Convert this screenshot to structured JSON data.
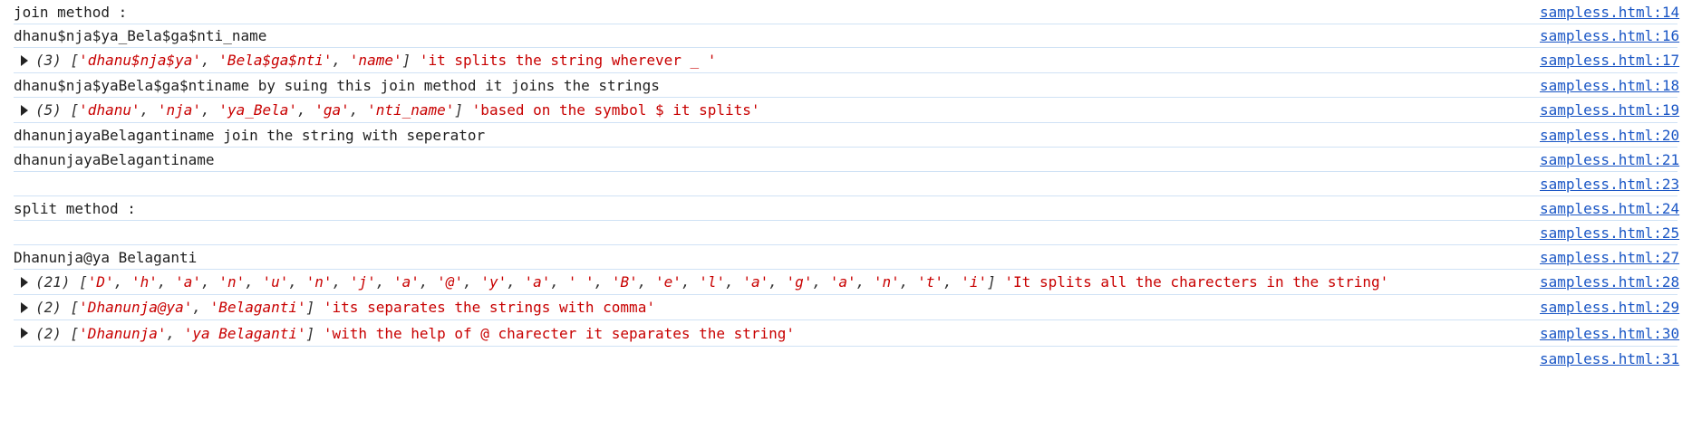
{
  "log": [
    {
      "kind": "text",
      "text": "join method :",
      "source": "sampless.html:14"
    },
    {
      "kind": "text",
      "text": "dhanu$nja$ya_Bela$ga$nti_name",
      "source": "sampless.html:16"
    },
    {
      "kind": "array",
      "count": "(3)",
      "items": [
        "'dhanu$nja$ya'",
        "'Bela$ga$nti'",
        "'name'"
      ],
      "note": "'it splits the string wherever _ '",
      "source": "sampless.html:17"
    },
    {
      "kind": "text",
      "text": "dhanu$nja$yaBela$ga$ntiname by suing this join method it joins the strings",
      "source": "sampless.html:18"
    },
    {
      "kind": "array",
      "count": "(5)",
      "items": [
        "'dhanu'",
        "'nja'",
        "'ya_Bela'",
        "'ga'",
        "'nti_name'"
      ],
      "note": "'based on the symbol $ it splits'",
      "source": "sampless.html:19"
    },
    {
      "kind": "text",
      "text": "dhanunjayaBelagantiname join the string with seperator",
      "source": "sampless.html:20"
    },
    {
      "kind": "text",
      "text": "dhanunjayaBelagantiname",
      "source": "sampless.html:21"
    },
    {
      "kind": "text",
      "text": "",
      "source": "sampless.html:23"
    },
    {
      "kind": "text",
      "text": "split method :",
      "source": "sampless.html:24"
    },
    {
      "kind": "text",
      "text": "",
      "source": "sampless.html:25"
    },
    {
      "kind": "text",
      "text": "Dhanunja@ya Belaganti",
      "source": "sampless.html:27"
    },
    {
      "kind": "array",
      "count": "(21)",
      "items": [
        "'D'",
        "'h'",
        "'a'",
        "'n'",
        "'u'",
        "'n'",
        "'j'",
        "'a'",
        "'@'",
        "'y'",
        "'a'",
        "' '",
        "'B'",
        "'e'",
        "'l'",
        "'a'",
        "'g'",
        "'a'",
        "'n'",
        "'t'",
        "'i'"
      ],
      "note": "'It splits all the charecters in the string'",
      "source": "sampless.html:28"
    },
    {
      "kind": "array",
      "count": "(2)",
      "items": [
        "'Dhanunja@ya'",
        "'Belaganti'"
      ],
      "note": "'its separates the strings with comma'",
      "source": "sampless.html:29"
    },
    {
      "kind": "array",
      "count": "(2)",
      "items": [
        "'Dhanunja'",
        "'ya Belaganti'"
      ],
      "note": "'with the help of @ charecter it separates the string'",
      "source": "sampless.html:30"
    },
    {
      "kind": "text",
      "text": "",
      "source": "sampless.html:31"
    }
  ]
}
